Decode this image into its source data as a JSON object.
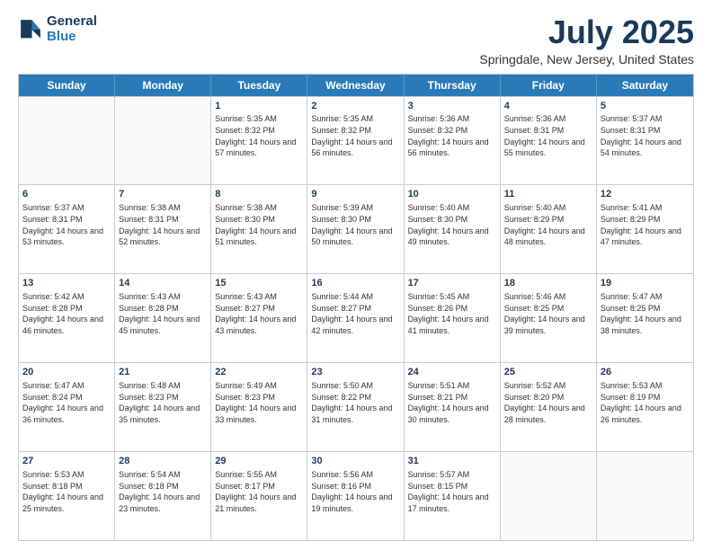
{
  "logo": {
    "line1": "General",
    "line2": "Blue"
  },
  "header": {
    "month": "July 2025",
    "location": "Springdale, New Jersey, United States"
  },
  "weekdays": [
    "Sunday",
    "Monday",
    "Tuesday",
    "Wednesday",
    "Thursday",
    "Friday",
    "Saturday"
  ],
  "rows": [
    [
      {
        "day": "",
        "text": "",
        "empty": true
      },
      {
        "day": "",
        "text": "",
        "empty": true
      },
      {
        "day": "1",
        "text": "Sunrise: 5:35 AM\nSunset: 8:32 PM\nDaylight: 14 hours and 57 minutes."
      },
      {
        "day": "2",
        "text": "Sunrise: 5:35 AM\nSunset: 8:32 PM\nDaylight: 14 hours and 56 minutes."
      },
      {
        "day": "3",
        "text": "Sunrise: 5:36 AM\nSunset: 8:32 PM\nDaylight: 14 hours and 56 minutes."
      },
      {
        "day": "4",
        "text": "Sunrise: 5:36 AM\nSunset: 8:31 PM\nDaylight: 14 hours and 55 minutes."
      },
      {
        "day": "5",
        "text": "Sunrise: 5:37 AM\nSunset: 8:31 PM\nDaylight: 14 hours and 54 minutes."
      }
    ],
    [
      {
        "day": "6",
        "text": "Sunrise: 5:37 AM\nSunset: 8:31 PM\nDaylight: 14 hours and 53 minutes."
      },
      {
        "day": "7",
        "text": "Sunrise: 5:38 AM\nSunset: 8:31 PM\nDaylight: 14 hours and 52 minutes."
      },
      {
        "day": "8",
        "text": "Sunrise: 5:38 AM\nSunset: 8:30 PM\nDaylight: 14 hours and 51 minutes."
      },
      {
        "day": "9",
        "text": "Sunrise: 5:39 AM\nSunset: 8:30 PM\nDaylight: 14 hours and 50 minutes."
      },
      {
        "day": "10",
        "text": "Sunrise: 5:40 AM\nSunset: 8:30 PM\nDaylight: 14 hours and 49 minutes."
      },
      {
        "day": "11",
        "text": "Sunrise: 5:40 AM\nSunset: 8:29 PM\nDaylight: 14 hours and 48 minutes."
      },
      {
        "day": "12",
        "text": "Sunrise: 5:41 AM\nSunset: 8:29 PM\nDaylight: 14 hours and 47 minutes."
      }
    ],
    [
      {
        "day": "13",
        "text": "Sunrise: 5:42 AM\nSunset: 8:28 PM\nDaylight: 14 hours and 46 minutes."
      },
      {
        "day": "14",
        "text": "Sunrise: 5:43 AM\nSunset: 8:28 PM\nDaylight: 14 hours and 45 minutes."
      },
      {
        "day": "15",
        "text": "Sunrise: 5:43 AM\nSunset: 8:27 PM\nDaylight: 14 hours and 43 minutes."
      },
      {
        "day": "16",
        "text": "Sunrise: 5:44 AM\nSunset: 8:27 PM\nDaylight: 14 hours and 42 minutes."
      },
      {
        "day": "17",
        "text": "Sunrise: 5:45 AM\nSunset: 8:26 PM\nDaylight: 14 hours and 41 minutes."
      },
      {
        "day": "18",
        "text": "Sunrise: 5:46 AM\nSunset: 8:25 PM\nDaylight: 14 hours and 39 minutes."
      },
      {
        "day": "19",
        "text": "Sunrise: 5:47 AM\nSunset: 8:25 PM\nDaylight: 14 hours and 38 minutes."
      }
    ],
    [
      {
        "day": "20",
        "text": "Sunrise: 5:47 AM\nSunset: 8:24 PM\nDaylight: 14 hours and 36 minutes."
      },
      {
        "day": "21",
        "text": "Sunrise: 5:48 AM\nSunset: 8:23 PM\nDaylight: 14 hours and 35 minutes."
      },
      {
        "day": "22",
        "text": "Sunrise: 5:49 AM\nSunset: 8:23 PM\nDaylight: 14 hours and 33 minutes."
      },
      {
        "day": "23",
        "text": "Sunrise: 5:50 AM\nSunset: 8:22 PM\nDaylight: 14 hours and 31 minutes."
      },
      {
        "day": "24",
        "text": "Sunrise: 5:51 AM\nSunset: 8:21 PM\nDaylight: 14 hours and 30 minutes."
      },
      {
        "day": "25",
        "text": "Sunrise: 5:52 AM\nSunset: 8:20 PM\nDaylight: 14 hours and 28 minutes."
      },
      {
        "day": "26",
        "text": "Sunrise: 5:53 AM\nSunset: 8:19 PM\nDaylight: 14 hours and 26 minutes."
      }
    ],
    [
      {
        "day": "27",
        "text": "Sunrise: 5:53 AM\nSunset: 8:18 PM\nDaylight: 14 hours and 25 minutes."
      },
      {
        "day": "28",
        "text": "Sunrise: 5:54 AM\nSunset: 8:18 PM\nDaylight: 14 hours and 23 minutes."
      },
      {
        "day": "29",
        "text": "Sunrise: 5:55 AM\nSunset: 8:17 PM\nDaylight: 14 hours and 21 minutes."
      },
      {
        "day": "30",
        "text": "Sunrise: 5:56 AM\nSunset: 8:16 PM\nDaylight: 14 hours and 19 minutes."
      },
      {
        "day": "31",
        "text": "Sunrise: 5:57 AM\nSunset: 8:15 PM\nDaylight: 14 hours and 17 minutes."
      },
      {
        "day": "",
        "text": "",
        "empty": true
      },
      {
        "day": "",
        "text": "",
        "empty": true
      }
    ]
  ]
}
